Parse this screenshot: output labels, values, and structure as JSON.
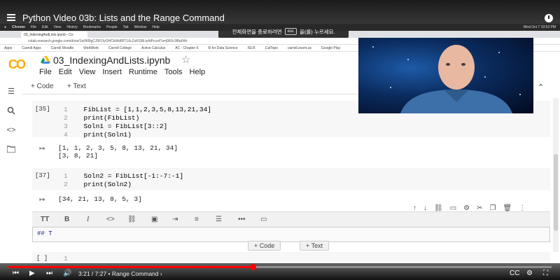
{
  "youtube": {
    "title": "Python Video 03b: Lists and the Range Command",
    "time_current": "3:21",
    "time_total": "7:27",
    "chapter": "Range Command",
    "progress": 0.45
  },
  "mac": {
    "app": "Chrome",
    "menus": [
      "File",
      "Edit",
      "View",
      "History",
      "Bookmarks",
      "People",
      "Tab",
      "Window",
      "Help"
    ],
    "datetime": "Wed Oct 7  10:53 PM"
  },
  "banner": {
    "pre": "전체화면을 종료하려면",
    "key": "esc",
    "post": "을(를) 누르세요."
  },
  "chrome": {
    "tab_title": "03_IndexingAndLists.ipynb - Co",
    "url": "colab.research.google.com/drive/1w9KBgCJ5FOyOHCbWd85TL6cZsKGBLtyfdPccrd?a=j960c3f8aFAh",
    "bookmarks": [
      "Apps",
      "Carroll Apps",
      "Carroll Moodle",
      "WebWork",
      "Carroll College",
      "Active Calculus",
      "AC - Chapter 6",
      "R for Data Science",
      "ISLR",
      "CalTopo",
      "carroll.zoom.us",
      "Google Play"
    ]
  },
  "colab": {
    "logo": "CO",
    "notebook_title": "03_IndexingAndLists.ipynb",
    "menu": [
      "File",
      "Edit",
      "View",
      "Insert",
      "Runtime",
      "Tools",
      "Help"
    ],
    "toolbar": {
      "code": "+ Code",
      "text": "+ Text"
    }
  },
  "cells": [
    {
      "prompt": "[35]",
      "lines": [
        {
          "n": "1",
          "code": "FibList = [1,1,2,3,5,8,13,21,34]"
        },
        {
          "n": "2",
          "code": "print(FibList)"
        },
        {
          "n": "3",
          "code": "Soln1 = FibList[3::2]"
        },
        {
          "n": "4",
          "code": "print(Soln1)"
        }
      ],
      "output": [
        "[1, 1, 2, 3, 5, 8, 13, 21, 34]",
        "[3, 8, 21]"
      ]
    },
    {
      "prompt": "[37]",
      "lines": [
        {
          "n": "1",
          "code": "Soln2 = FibList[-1:-7:-1]"
        },
        {
          "n": "2",
          "code": "print(Soln2)"
        }
      ],
      "output": [
        "[34, 21, 13, 8, 5, 3]"
      ]
    },
    {
      "prompt": "[ ]",
      "lines": [
        {
          "n": "1",
          "code": ""
        }
      ]
    }
  ],
  "text_cell": {
    "content": "## T"
  },
  "add_buttons": {
    "code": "+ Code",
    "text": "+ Text"
  }
}
